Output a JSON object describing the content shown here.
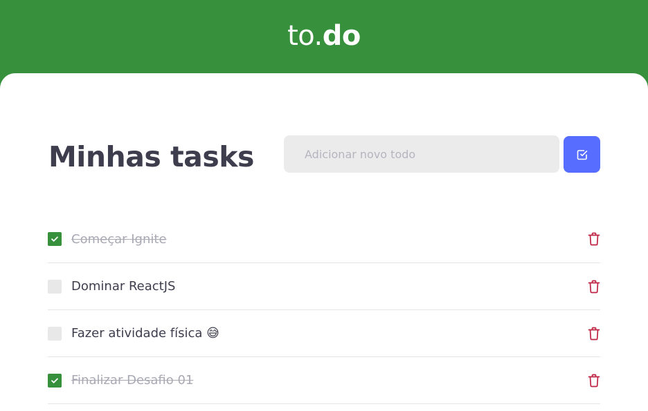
{
  "header": {
    "logo_to": "to.",
    "logo_do": "do"
  },
  "main": {
    "title": "Minhas tasks",
    "new_todo_placeholder": "Adicionar novo todo",
    "add_button_icon": "check-square-icon"
  },
  "tasks": [
    {
      "label": "Começar Ignite",
      "done": true
    },
    {
      "label": "Dominar ReactJS",
      "done": false
    },
    {
      "label": "Fazer atividade física 😅",
      "done": false
    },
    {
      "label": "Finalizar Desafio 01",
      "done": true
    }
  ],
  "colors": {
    "brand_green": "#37903c",
    "accent_blue": "#566dff",
    "trash_red": "#bf2344",
    "title_text": "#3d3d4d",
    "done_text": "#a9a9b4"
  }
}
